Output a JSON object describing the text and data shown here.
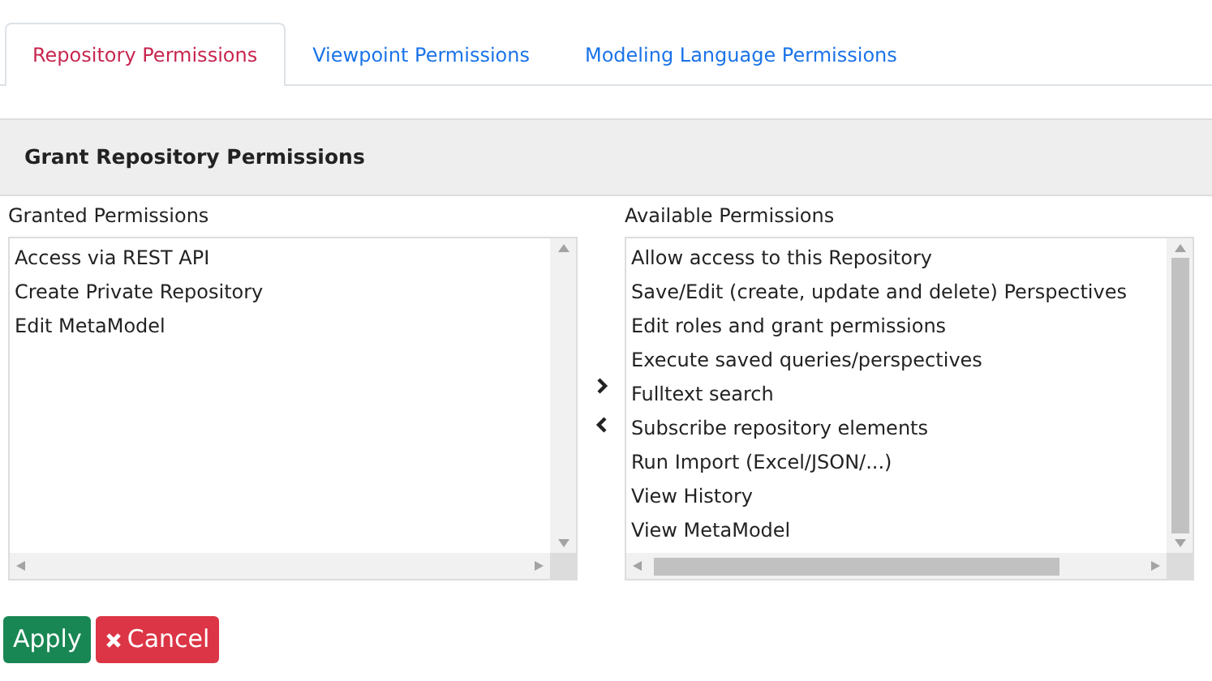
{
  "tabs": [
    {
      "label": "Repository Permissions",
      "selected": true
    },
    {
      "label": "Viewpoint Permissions",
      "selected": false
    },
    {
      "label": "Modeling Language Permissions",
      "selected": false
    }
  ],
  "panel": {
    "title": "Grant Repository Permissions"
  },
  "granted": {
    "label": "Granted Permissions",
    "items": [
      "Access via REST API",
      "Create Private Repository",
      "Edit MetaModel"
    ]
  },
  "available": {
    "label": "Available Permissions",
    "items": [
      "Allow access to this Repository",
      "Save/Edit (create, update and delete) Perspectives",
      "Edit roles and grant permissions",
      "Execute saved queries/perspectives",
      "Fulltext search",
      "Subscribe repository elements",
      "Run Import (Excel/JSON/...)",
      "View History",
      "View MetaModel"
    ]
  },
  "buttons": [
    {
      "label": "Apply",
      "kind": "apply"
    },
    {
      "label": "Cancel",
      "kind": "cancel"
    }
  ]
}
